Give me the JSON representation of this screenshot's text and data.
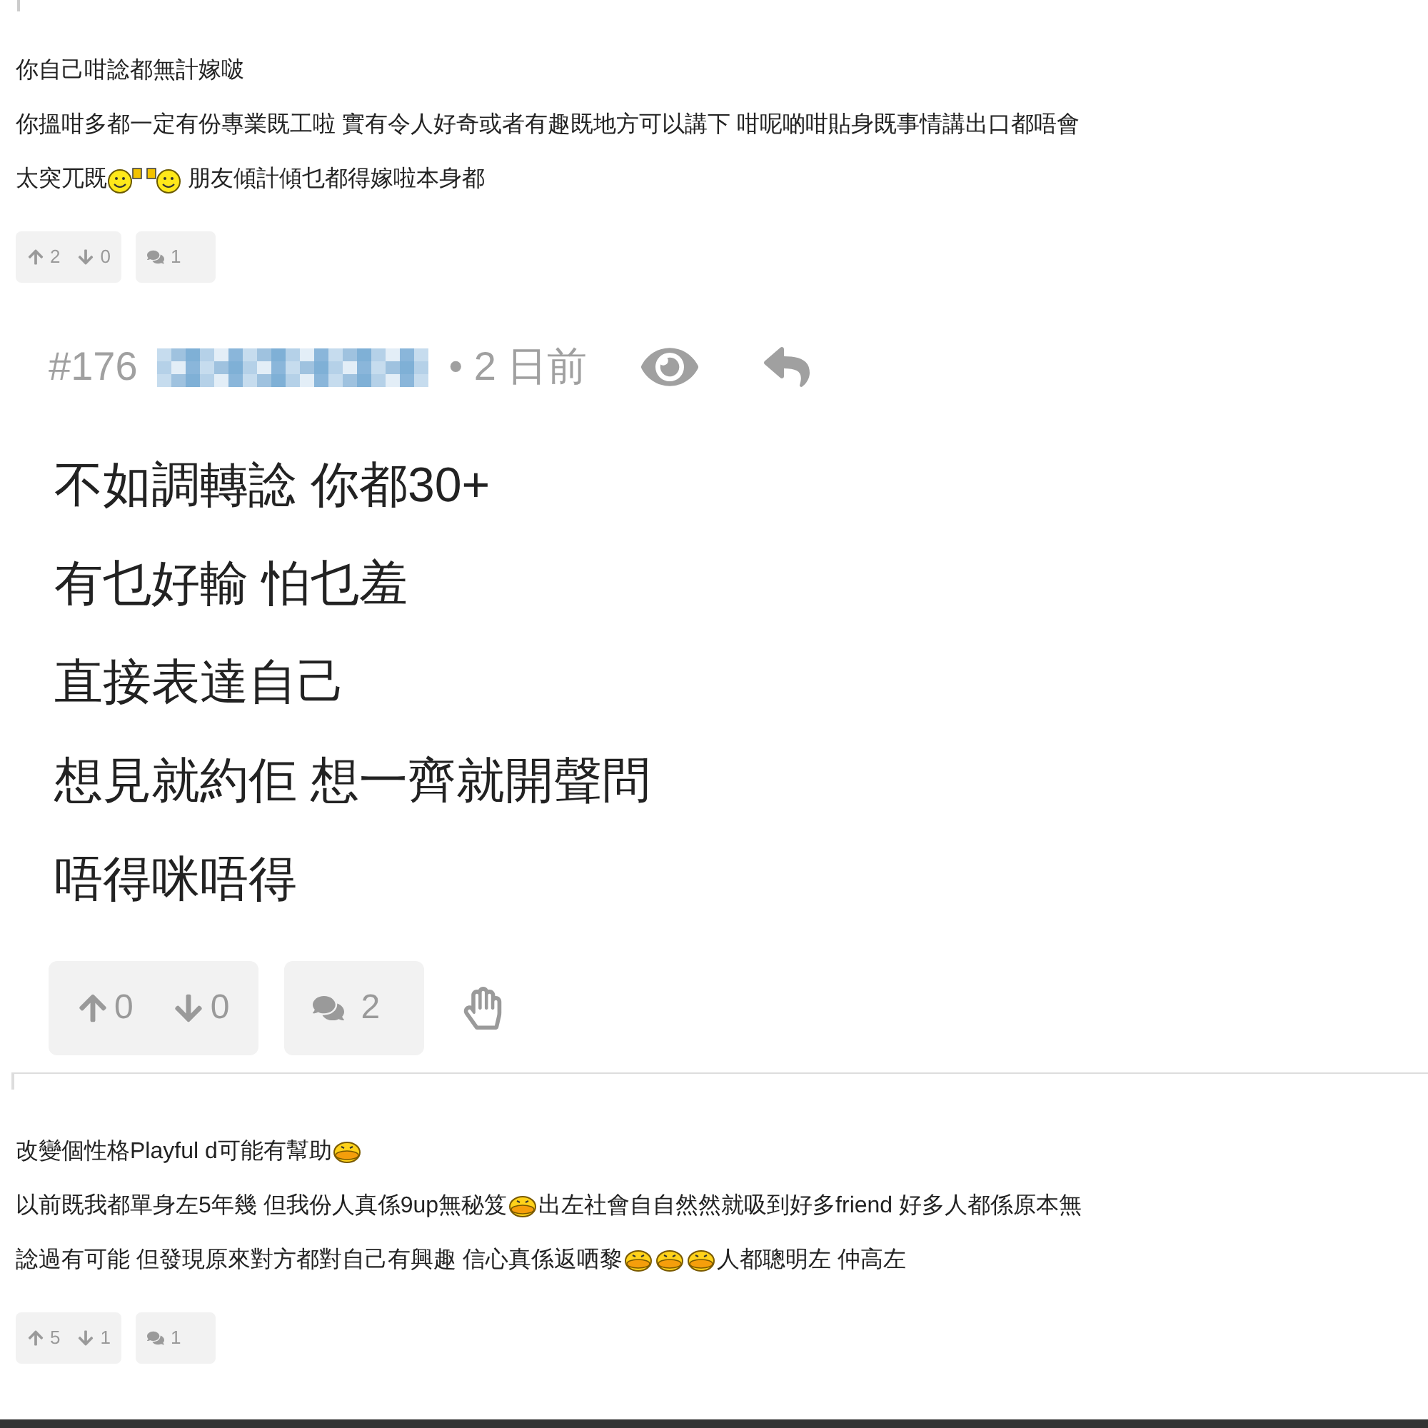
{
  "posts": [
    {
      "kind": "small",
      "lines": [
        [
          {
            "kind": "text",
            "text": "你自己咁諗都無計嫁啵"
          }
        ],
        [
          {
            "kind": "text",
            "text": "你搵咁多都一定有份專業既工啦 實有令人好奇或者有趣既地方可以講下 咁呢啲咁貼身既事情講出口都唔會"
          }
        ],
        [
          {
            "kind": "text",
            "text": "太突兀既"
          },
          {
            "kind": "cheers-left"
          },
          {
            "kind": "cheers-right"
          },
          {
            "kind": "text",
            "text": " 朋友傾計傾乜都得嫁啦本身都"
          }
        ]
      ],
      "upvotes": "2",
      "downvotes": "0",
      "replies": "1"
    },
    {
      "kind": "large",
      "number": "#176",
      "time": "• 2 日前",
      "lines": [
        [
          {
            "kind": "text",
            "text": "不如調轉諗 你都30+"
          }
        ],
        [
          {
            "kind": "text",
            "text": "有乜好輸 怕乜羞"
          }
        ],
        [
          {
            "kind": "text",
            "text": "直接表達自己"
          }
        ],
        [
          {
            "kind": "text",
            "text": "想見就約佢 想一齊就開聲問"
          }
        ],
        [
          {
            "kind": "text",
            "text": "唔得咪唔得"
          }
        ]
      ],
      "upvotes": "0",
      "downvotes": "0",
      "replies": "2"
    },
    {
      "kind": "small",
      "lines": [
        [
          {
            "kind": "text",
            "text": "改變個性格Playful d可能有幫助"
          },
          {
            "kind": "lips"
          }
        ],
        [
          {
            "kind": "text",
            "text": "以前既我都單身左5年幾 但我份人真係9up無秘笈"
          },
          {
            "kind": "lips"
          },
          {
            "kind": "text",
            "text": "出左社會自自然然就吸到好多friend 好多人都係原本無"
          }
        ],
        [
          {
            "kind": "text",
            "text": "諗過有可能 但發現原來對方都對自己有興趣 信心真係返哂黎"
          },
          {
            "kind": "lips"
          },
          {
            "kind": "lips"
          },
          {
            "kind": "lips"
          },
          {
            "kind": "text",
            "text": "人都聰明左 仲高左"
          }
        ]
      ],
      "upvotes": "5",
      "downvotes": "1",
      "replies": "1"
    }
  ]
}
